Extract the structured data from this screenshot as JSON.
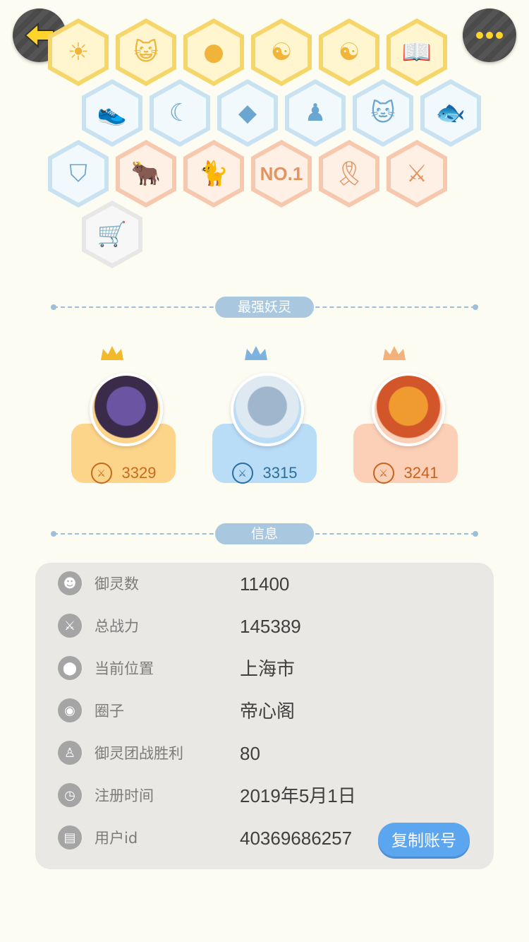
{
  "header": {
    "back_icon": "back-arrow-icon",
    "more_icon": "more-dots-icon"
  },
  "badges": [
    {
      "name": "badge-gold-sun-icon",
      "tier": "gold"
    },
    {
      "name": "badge-gold-cat-face-icon",
      "tier": "gold"
    },
    {
      "name": "badge-gold-orb-icon",
      "tier": "gold"
    },
    {
      "name": "badge-gold-yinyang-comet-icon",
      "tier": "gold"
    },
    {
      "name": "badge-gold-yinyang-box-icon",
      "tier": "gold"
    },
    {
      "name": "badge-gold-fox-book-icon",
      "tier": "gold"
    },
    {
      "name": "badge-blue-sneaker-icon",
      "tier": "blue"
    },
    {
      "name": "badge-blue-moon-icon",
      "tier": "blue"
    },
    {
      "name": "badge-blue-crystal-icon",
      "tier": "blue"
    },
    {
      "name": "badge-blue-figure-icon",
      "tier": "blue"
    },
    {
      "name": "badge-blue-cat-icon",
      "tier": "blue"
    },
    {
      "name": "badge-blue-koi-icon",
      "tier": "blue"
    },
    {
      "name": "badge-blue-shield-icon",
      "tier": "blue"
    },
    {
      "name": "badge-peach-ox-icon",
      "tier": "peach"
    },
    {
      "name": "badge-peach-cats-icon",
      "tier": "peach"
    },
    {
      "name": "badge-peach-no1-icon",
      "tier": "peach",
      "text": "NO.1"
    },
    {
      "name": "badge-peach-banner-icon",
      "tier": "peach"
    },
    {
      "name": "badge-peach-swords-icon",
      "tier": "peach"
    },
    {
      "name": "badge-grey-stroller-icon",
      "tier": "grey"
    }
  ],
  "spirits_section": {
    "title": "最强妖灵"
  },
  "spirits": [
    {
      "power": "3329",
      "color": "#fcd58a",
      "text_color": "#c76a1f",
      "crown_color": "#f2b92b"
    },
    {
      "power": "3315",
      "color": "#b9dcf7",
      "text_color": "#2c6e9e",
      "crown_color": "#7fb3df"
    },
    {
      "power": "3241",
      "color": "#fcd0b7",
      "text_color": "#c9621f",
      "crown_color": "#f2b27a"
    }
  ],
  "info_section": {
    "title": "信息"
  },
  "info": {
    "rows": [
      {
        "icon": "spirit-count-icon",
        "label": "御灵数",
        "value": "11400"
      },
      {
        "icon": "sword-icon",
        "label": "总战力",
        "value": "145389"
      },
      {
        "icon": "location-pin-icon",
        "label": "当前位置",
        "value": "上海市"
      },
      {
        "icon": "circle-group-icon",
        "label": "圈子",
        "value": "帝心阁"
      },
      {
        "icon": "trophy-figure-icon",
        "label": "御灵团战胜利",
        "value": "80"
      },
      {
        "icon": "clock-icon",
        "label": "注册时间",
        "value": "2019年5月1日"
      },
      {
        "icon": "id-card-icon",
        "label": "用户id",
        "value": "40369686257"
      }
    ],
    "copy_button": "复制账号"
  }
}
